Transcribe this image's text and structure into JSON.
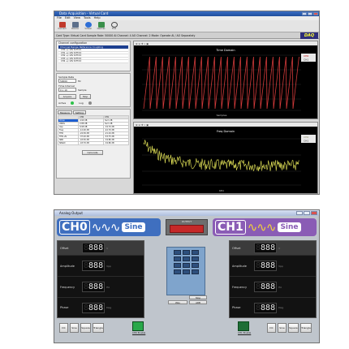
{
  "daq": {
    "window_title": "Data Acquisition - Virtual Card",
    "menu": [
      "File",
      "Edit",
      "View",
      "Tools",
      "Help"
    ],
    "toolbar": [
      "Connect",
      "Device",
      "Virtual",
      "Devices",
      "Find"
    ],
    "config_line": "Card Type: Virtual Card   Sample Rate: 50000   AI Channel: 4   AO Channel: 2   Mode: Operate AI / AO Separately",
    "brand": "DAQ",
    "channel_config": {
      "title": "Channel configuration",
      "header": "Channel  Range  Reference  Coupling",
      "rows": [
        "CH0  +/-10V  Diff  DC",
        "CH1  +/-10V  Diff  DC",
        "CH2  +/-10V  Diff  DC",
        "CH3  +/-10V  Diff  DC",
        "CH4  +/-10V  Diff  DC"
      ]
    },
    "sample_rate": {
      "label": "Sample Rate",
      "value": "50000",
      "unit": "Hz"
    },
    "time_span": {
      "label": "Time Interval",
      "value": "0 x 10",
      "unit": "Sample"
    },
    "acquire_button": "Acquire",
    "stop_button": "Stop",
    "active_label": "Active",
    "log_label": "Log",
    "meas_tabs": [
      "Measure",
      "Setting"
    ],
    "meas_table": {
      "headers": [
        "",
        "CH0",
        "CH1"
      ],
      "rows": [
        [
          "Vmax",
          "4.99 dB",
          "Sum dB"
        ],
        [
          "VRMS",
          "2.88 dB",
          "Sum dB"
        ],
        [
          "Vpp",
          "9.98 dB",
          "-34.70 dB"
        ],
        [
          "Freq",
          "-12.00 dB",
          "-42.70 dB"
        ],
        [
          "THD",
          "-24.36 dB",
          "-21.44 dB"
        ],
        [
          "THD+N",
          "-37.20 dB",
          "-53.75 dB"
        ],
        [
          "SNR",
          "-43.50 dB",
          "-34.86 dB"
        ],
        [
          "SINAD",
          "-43.70 dB",
          "-34.86 dB"
        ]
      ]
    },
    "calc_button": "Calculate",
    "time_plot": {
      "title": "Time Domain",
      "xlabel": "Samples",
      "legend": [
        "CH0",
        "CH1"
      ]
    },
    "freq_plot": {
      "title": "Freq Domain",
      "xlabel": "KHz",
      "legend": [
        "CH0",
        "CH1"
      ]
    }
  },
  "ao": {
    "window_title": "Analog Output",
    "ch0": {
      "label": "CH0",
      "wave": "Sine",
      "color": "#3f6fbf"
    },
    "ch1": {
      "label": "CH1",
      "wave": "Sine",
      "color": "#8a5cb5"
    },
    "output_label": "OUTPUT",
    "param_labels": [
      "Offset",
      "Amplitude",
      "Frequency",
      "Phase"
    ],
    "units": [
      "V",
      "Vpp",
      "Hz",
      "Deg"
    ],
    "digits": "888",
    "keypad_buttons": [
      "Stop",
      "ARB",
      "Wav"
    ],
    "wave_buttons": [
      "DC",
      "Sine",
      "Square",
      "Triangle"
    ],
    "enable_ch0": "CH0 Enable",
    "enable_ch1": "CH1 Enable"
  },
  "colors": {
    "signal_red": "#d23a3a",
    "signal_yellow": "#e8e85a",
    "blue_header": "#1d3f8f"
  }
}
